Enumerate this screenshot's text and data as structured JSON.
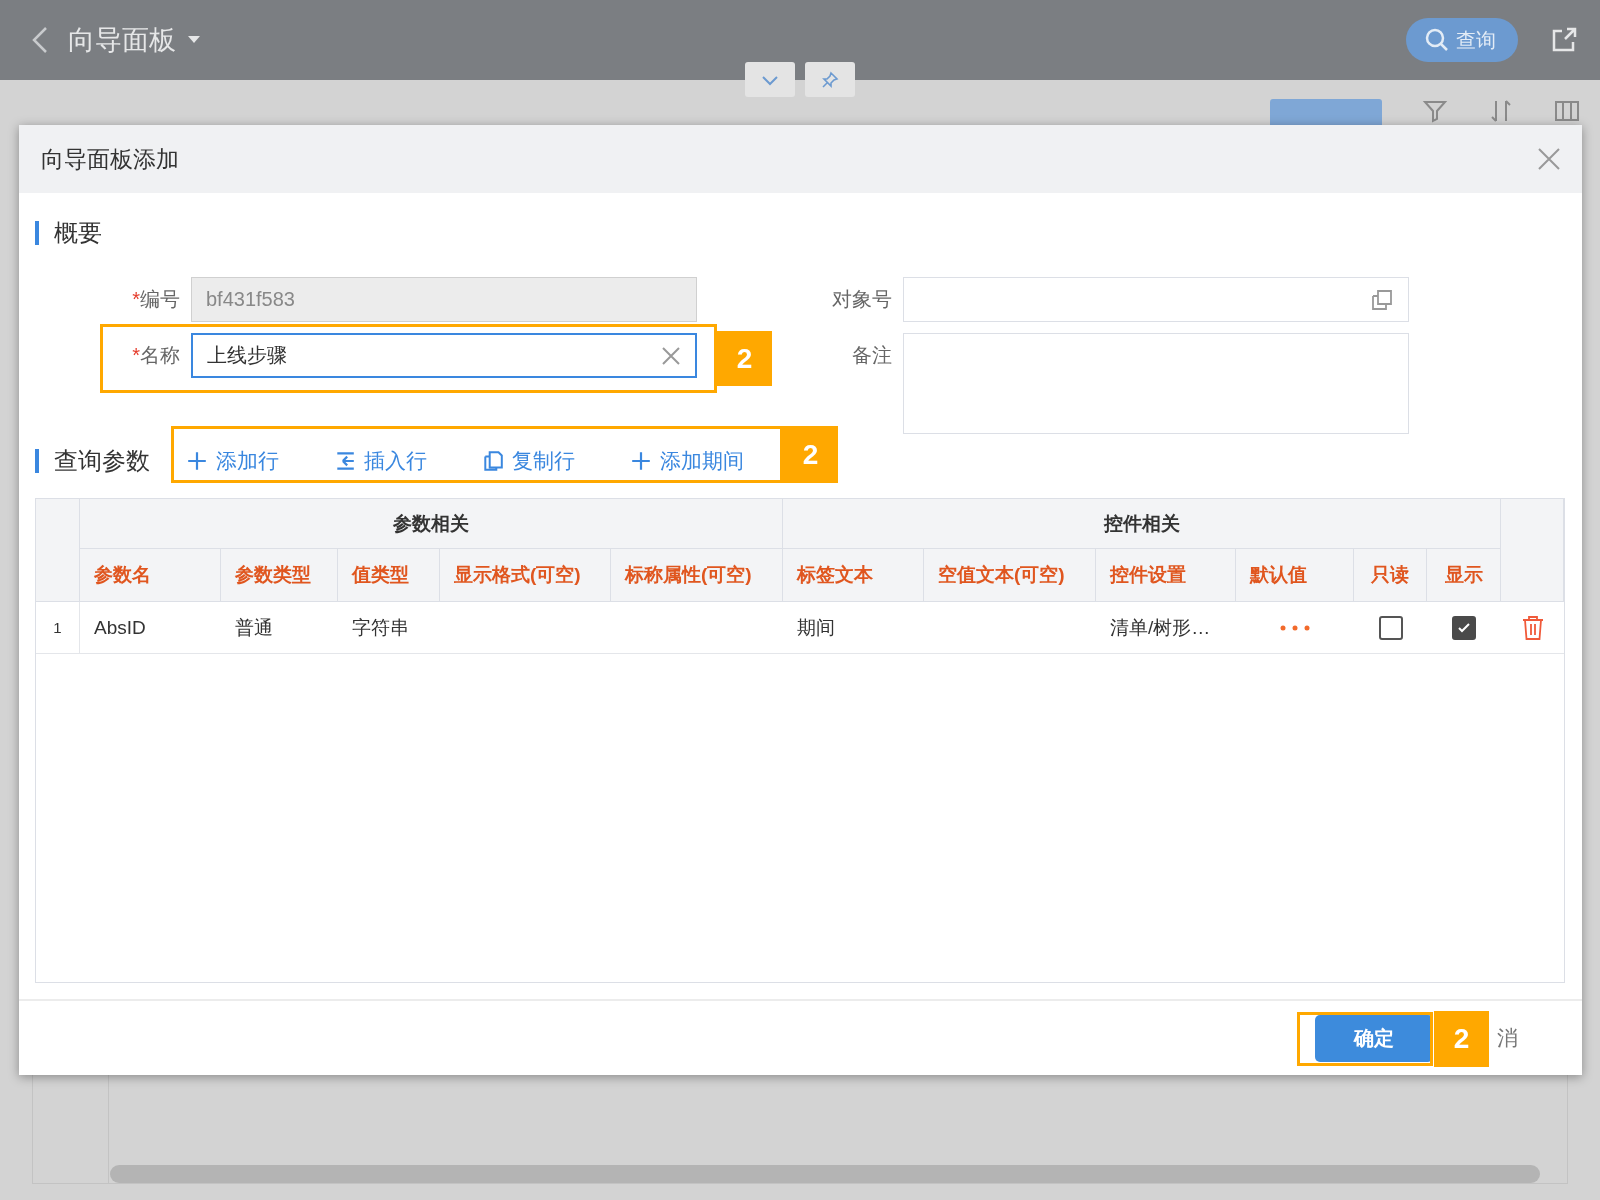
{
  "top_bar": {
    "title": "向导面板",
    "search_button": "查询"
  },
  "dialog": {
    "title": "向导面板添加",
    "summary": {
      "title": "概要",
      "required_mark": "*",
      "left_fields": [
        {
          "label": "编号",
          "value": "bf431f583",
          "required": true,
          "disabled": true,
          "focused": false,
          "kind": "text"
        },
        {
          "label": "名称",
          "value": "上线步骤",
          "required": true,
          "disabled": false,
          "focused": true,
          "kind": "text"
        }
      ],
      "right_fields": [
        {
          "label": "对象号",
          "required": false,
          "disabled": false,
          "focused": false,
          "kind": "lookup"
        },
        {
          "label": "备注",
          "required": false,
          "disabled": false,
          "focused": false,
          "kind": "textarea"
        }
      ]
    },
    "query": {
      "title": "查询参数",
      "actions": [
        {
          "label": "添加行",
          "kind": "add"
        },
        {
          "label": "插入行",
          "kind": "insert"
        },
        {
          "label": "复制行",
          "kind": "copy"
        },
        {
          "label": "添加期间",
          "kind": "add"
        }
      ],
      "column_groups": [
        {
          "label": "参数相关",
          "columns": [
            "参数名",
            "参数类型",
            "值类型",
            "显示格式(可空)",
            "标称属性(可空)"
          ]
        },
        {
          "label": "控件相关",
          "columns": [
            "标签文本",
            "空值文本(可空)",
            "控件设置",
            "默认值",
            "只读",
            "显示"
          ]
        }
      ],
      "rows": [
        {
          "index": "1",
          "param_name": "AbsID",
          "param_type": "普通",
          "value_type": "字符串",
          "label_text": "期间",
          "control_setting": "清单/树形…",
          "readonly": false,
          "display": true
        }
      ]
    },
    "confirm_button": "确定",
    "cancel_button": "消",
    "annotations": [
      "2",
      "2",
      "2"
    ]
  }
}
